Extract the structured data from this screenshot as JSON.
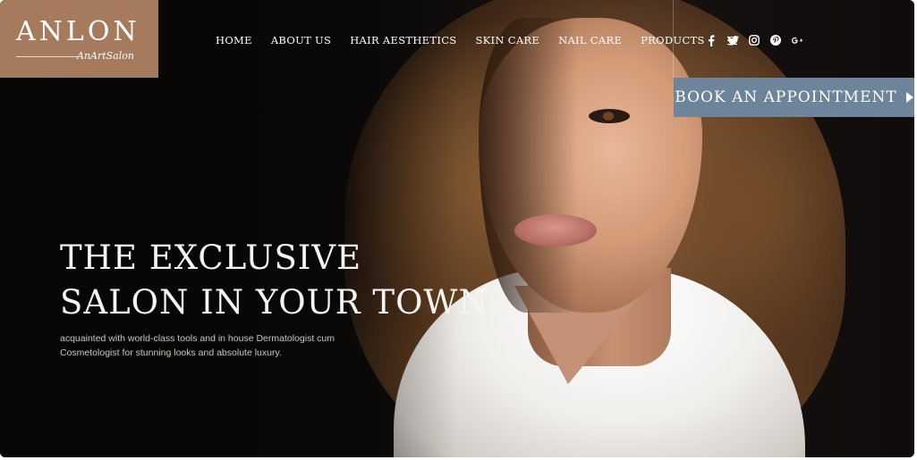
{
  "logo": {
    "title": "ANLON",
    "subtitle": "AnArtSalon"
  },
  "nav": {
    "items": [
      {
        "label": "HOME"
      },
      {
        "label": "ABOUT US"
      },
      {
        "label": "HAIR AESTHETICS"
      },
      {
        "label": "SKIN CARE"
      },
      {
        "label": "NAIL CARE"
      },
      {
        "label": "PRODUCTS"
      }
    ],
    "menu_icon": "hamburger-icon"
  },
  "social": [
    "facebook-icon",
    "twitter-icon",
    "instagram-icon",
    "pinterest-icon",
    "google-plus-icon"
  ],
  "cta": {
    "label": "BOOK AN APPOINTMENT",
    "icon": "play-arrow-icon"
  },
  "hero": {
    "headline_line1": "THE EXCLUSIVE",
    "headline_line2": "SALON IN YOUR TOWN",
    "subtext_line1": "acquainted with world-class tools and in house Dermatologist cum",
    "subtext_line2": "Cosmetologist for stunning looks and absolute luxury."
  },
  "colors": {
    "brand": "#a57a5d",
    "cta": "#6e849a",
    "background": "#0b0908"
  }
}
